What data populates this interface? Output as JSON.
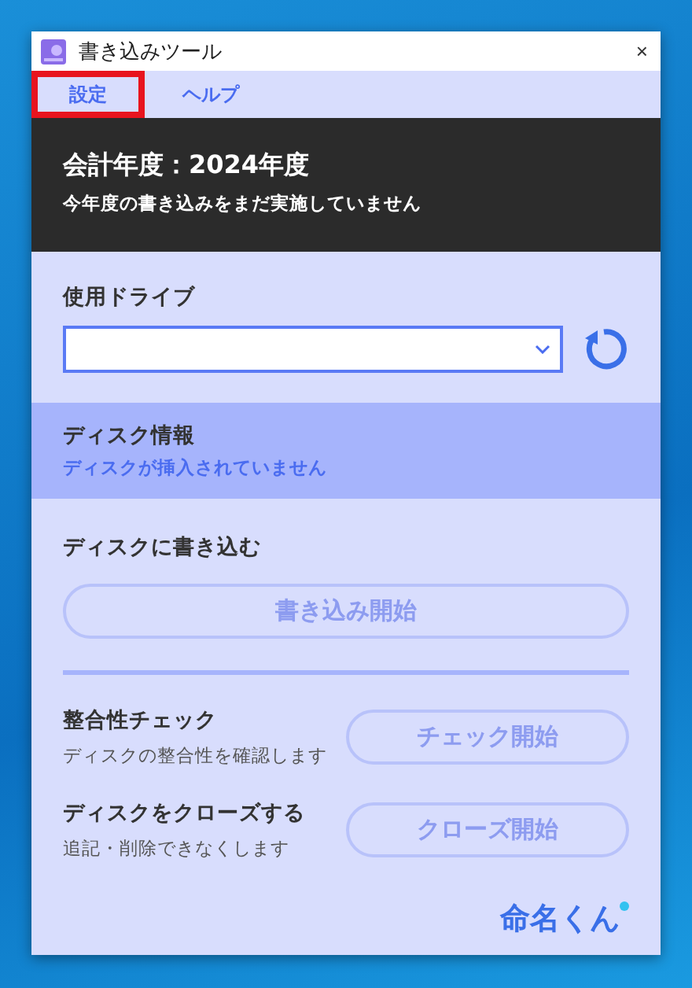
{
  "window": {
    "title": "書き込みツール",
    "close": "×"
  },
  "menu": [
    {
      "label": "設定",
      "highlighted": true
    },
    {
      "label": "ヘルプ",
      "highlighted": false
    }
  ],
  "header": {
    "title": "会計年度：2024年度",
    "subtitle": "今年度の書き込みをまだ実施していません"
  },
  "drive": {
    "label": "使用ドライブ"
  },
  "disk_info": {
    "title": "ディスク情報",
    "status": "ディスクが挿入されていません"
  },
  "write": {
    "title": "ディスクに書き込む",
    "button": {
      "label": "書き込み開始",
      "disabled": true
    }
  },
  "actions": [
    {
      "title": "整合性チェック",
      "description": "ディスクの整合性を確認します",
      "button": {
        "label": "チェック開始",
        "disabled": true
      }
    },
    {
      "title": "ディスクをクローズする",
      "description": "追記・削除できなくします",
      "button": {
        "label": "クローズ開始",
        "disabled": true
      }
    }
  ],
  "logo": {
    "text": "命名くん"
  }
}
